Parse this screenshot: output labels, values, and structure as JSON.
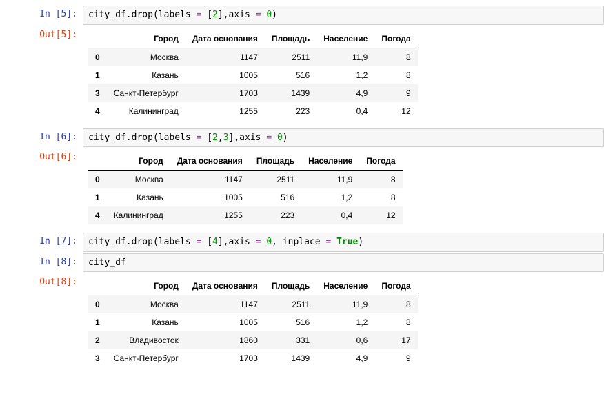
{
  "prompts": {
    "in5": "In [5]:",
    "out5": "Out[5]:",
    "in6": "In [6]:",
    "out6": "Out[6]:",
    "in7": "In [7]:",
    "in8": "In [8]:",
    "out8": "Out[8]:"
  },
  "code5": {
    "full": "city_df.drop(labels = [2],axis = 0)",
    "parts": [
      "city_df.drop(labels ",
      "=",
      " [",
      "2",
      "],axis ",
      "=",
      " ",
      "0",
      ")"
    ]
  },
  "code6": {
    "full": "city_df.drop(labels = [2,3],axis = 0)",
    "parts": [
      "city_df.drop(labels ",
      "=",
      " [",
      "2",
      ",",
      "3",
      "],axis ",
      "=",
      " ",
      "0",
      ")"
    ]
  },
  "code7": {
    "full": "city_df.drop(labels = [4],axis = 0, inplace = True)",
    "parts": [
      "city_df.drop(labels ",
      "=",
      " [",
      "4",
      "],axis ",
      "=",
      " ",
      "0",
      ", inplace ",
      "=",
      " ",
      "True",
      ")"
    ]
  },
  "code8": {
    "full": "city_df"
  },
  "table": {
    "columns": [
      "Город",
      "Дата основания",
      "Площадь",
      "Население",
      "Погода"
    ]
  },
  "out5_rows": [
    {
      "idx": "0",
      "c": [
        "Москва",
        "1147",
        "2511",
        "11,9",
        "8"
      ]
    },
    {
      "idx": "1",
      "c": [
        "Казань",
        "1005",
        "516",
        "1,2",
        "8"
      ]
    },
    {
      "idx": "3",
      "c": [
        "Санкт-Петербург",
        "1703",
        "1439",
        "4,9",
        "9"
      ]
    },
    {
      "idx": "4",
      "c": [
        "Калининград",
        "1255",
        "223",
        "0,4",
        "12"
      ]
    }
  ],
  "out6_rows": [
    {
      "idx": "0",
      "c": [
        "Москва",
        "1147",
        "2511",
        "11,9",
        "8"
      ]
    },
    {
      "idx": "1",
      "c": [
        "Казань",
        "1005",
        "516",
        "1,2",
        "8"
      ]
    },
    {
      "idx": "4",
      "c": [
        "Калининград",
        "1255",
        "223",
        "0,4",
        "12"
      ]
    }
  ],
  "out8_rows": [
    {
      "idx": "0",
      "c": [
        "Москва",
        "1147",
        "2511",
        "11,9",
        "8"
      ]
    },
    {
      "idx": "1",
      "c": [
        "Казань",
        "1005",
        "516",
        "1,2",
        "8"
      ]
    },
    {
      "idx": "2",
      "c": [
        "Владивосток",
        "1860",
        "331",
        "0,6",
        "17"
      ]
    },
    {
      "idx": "3",
      "c": [
        "Санкт-Петербург",
        "1703",
        "1439",
        "4,9",
        "9"
      ]
    }
  ]
}
